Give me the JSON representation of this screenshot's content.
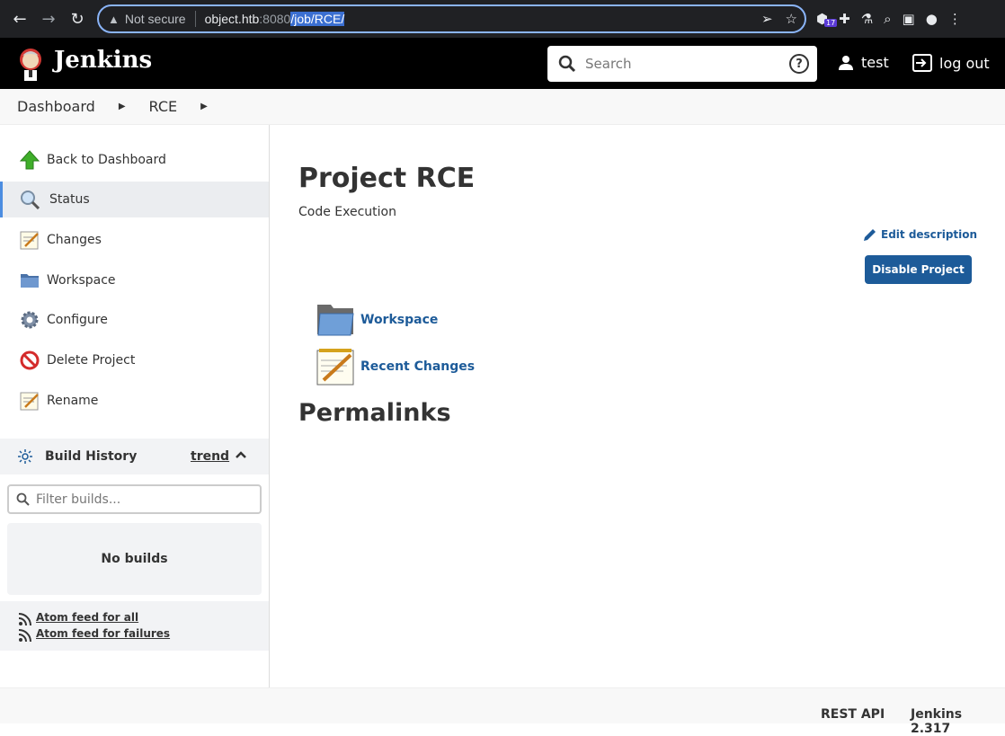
{
  "browser": {
    "security_label": "Not secure",
    "url_host": "object.htb",
    "url_port": ":8080",
    "url_path": "/job/RCE/",
    "extension_badge": "17"
  },
  "header": {
    "brand": "Jenkins",
    "search_placeholder": "Search",
    "help_glyph": "?",
    "user": "test",
    "logout": "log out"
  },
  "breadcrumbs": [
    "Dashboard",
    "RCE"
  ],
  "sidebar": {
    "tasks": [
      {
        "label": "Back to Dashboard",
        "icon": "up-arrow-icon"
      },
      {
        "label": "Status",
        "icon": "magnifier-icon"
      },
      {
        "label": "Changes",
        "icon": "notepad-icon"
      },
      {
        "label": "Workspace",
        "icon": "folder-icon"
      },
      {
        "label": "Configure",
        "icon": "gear-icon"
      },
      {
        "label": "Delete Project",
        "icon": "no-entry-icon"
      },
      {
        "label": "Rename",
        "icon": "notepad-icon"
      }
    ],
    "active_task": "Status",
    "build_history": {
      "title": "Build History",
      "trend": "trend",
      "filter_placeholder": "Filter builds...",
      "empty": "No builds",
      "feed_all": "Atom feed for all",
      "feed_failures": "Atom feed for failures"
    }
  },
  "main": {
    "title": "Project RCE",
    "description": "Code Execution",
    "edit_description": "Edit description",
    "disable_button": "Disable Project",
    "links": [
      {
        "label": "Workspace",
        "icon": "folder-icon"
      },
      {
        "label": "Recent Changes",
        "icon": "notepad-icon"
      }
    ],
    "permalinks_heading": "Permalinks"
  },
  "footer": {
    "rest_api": "REST API",
    "version": "Jenkins 2.317"
  },
  "colors": {
    "link_blue": "#1d5b99",
    "header_black": "#000000",
    "active_accent": "#4c8de1"
  }
}
